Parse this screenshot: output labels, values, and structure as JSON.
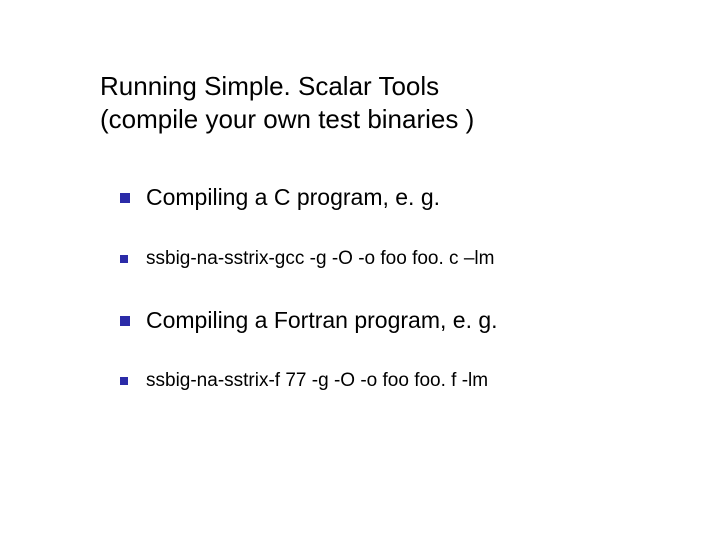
{
  "title_line1": "Running Simple. Scalar Tools",
  "title_line2": "(compile your own test binaries )",
  "bullets": [
    {
      "size": "lg",
      "text": "Compiling a C program, e. g."
    },
    {
      "size": "sm",
      "text": "ssbig-na-sstrix-gcc -g -O -o foo foo. c –lm"
    },
    {
      "size": "lg",
      "text": "Compiling a Fortran program, e. g."
    },
    {
      "size": "sm",
      "text": "ssbig-na-sstrix-f 77 -g -O -o foo foo. f -lm"
    }
  ]
}
